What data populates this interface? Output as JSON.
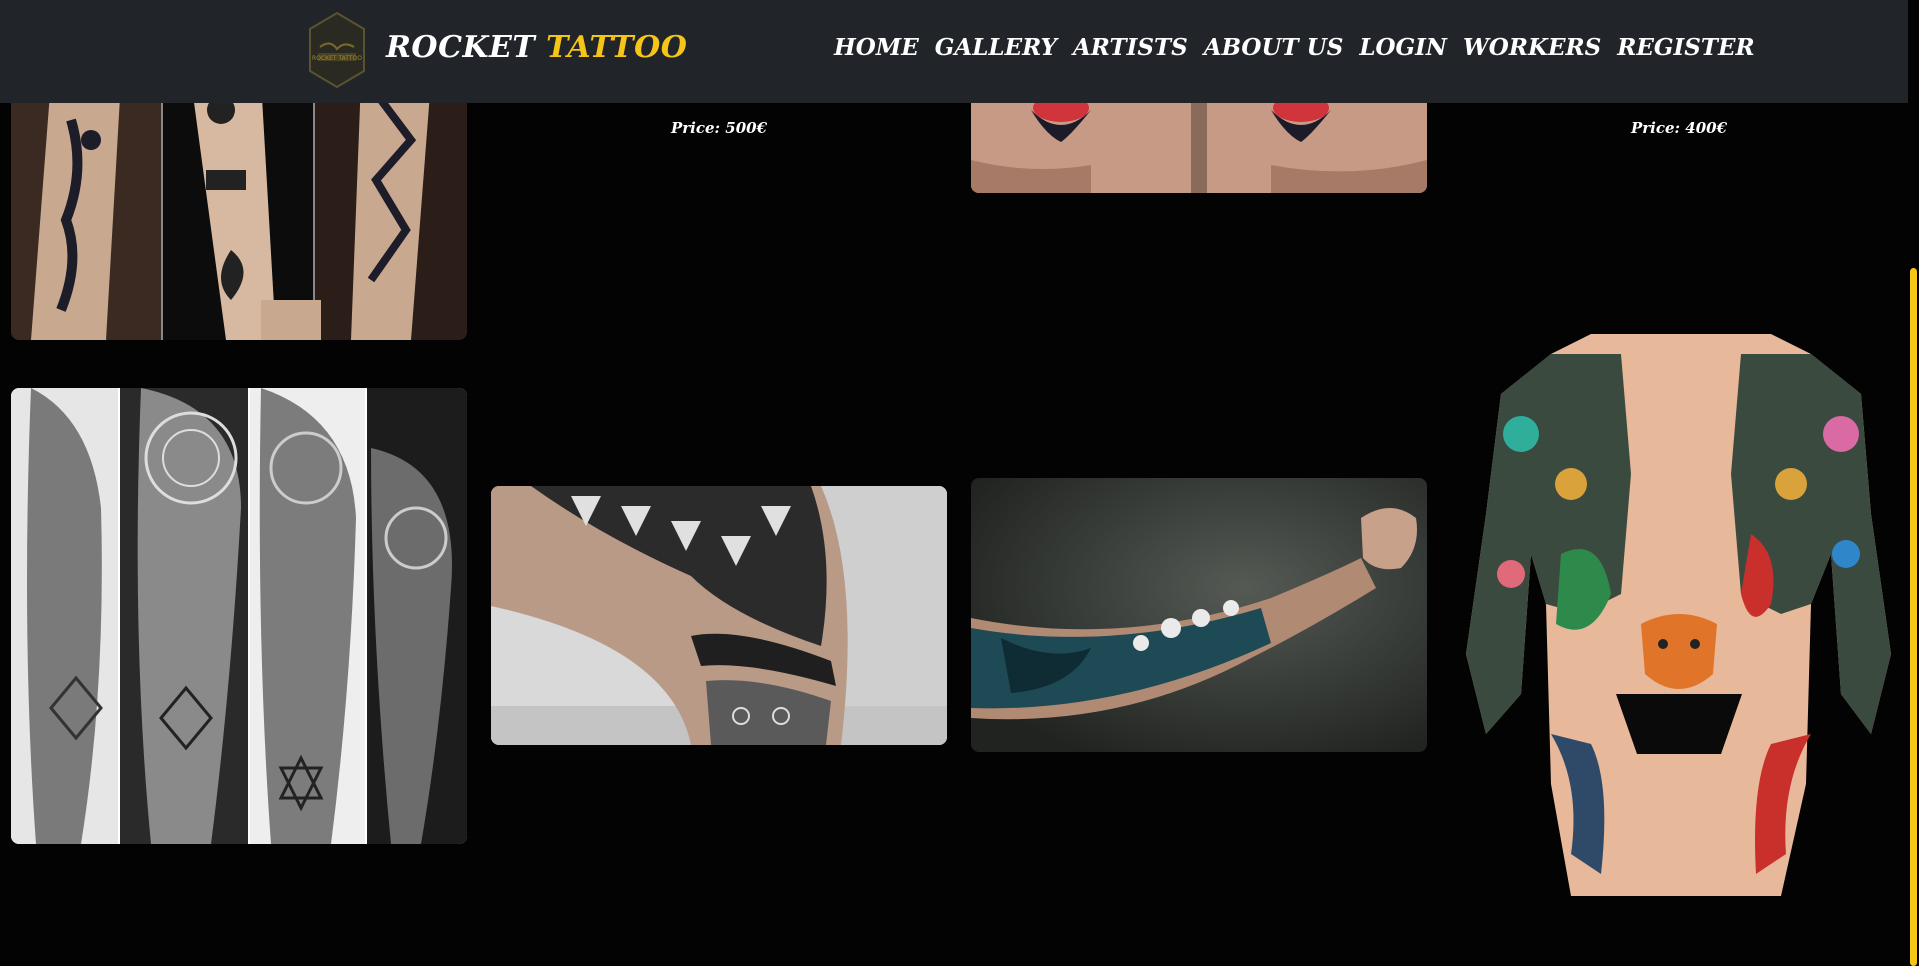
{
  "brand": {
    "name_part1": "ROCKET",
    "name_part2": "TATTOO",
    "logo_text": "ROCKET TATTOO",
    "accent_color": "#f5c518"
  },
  "nav": {
    "items": [
      "HOME",
      "GALLERY",
      "ARTISTS",
      "ABOUT US",
      "LOGIN",
      "WORKERS",
      "REGISTER"
    ]
  },
  "gallery": {
    "prices": [
      "Price: 500€",
      "Price: 400€"
    ],
    "images": [
      "old-school-forearm-tattoos",
      "swallow-hand-tattoos",
      "mandala-sleeve-tattoos",
      "geometric-leg-tattoo",
      "japanese-arm-sleeve-tattoo",
      "japanese-bodysuit-tattoo"
    ]
  }
}
